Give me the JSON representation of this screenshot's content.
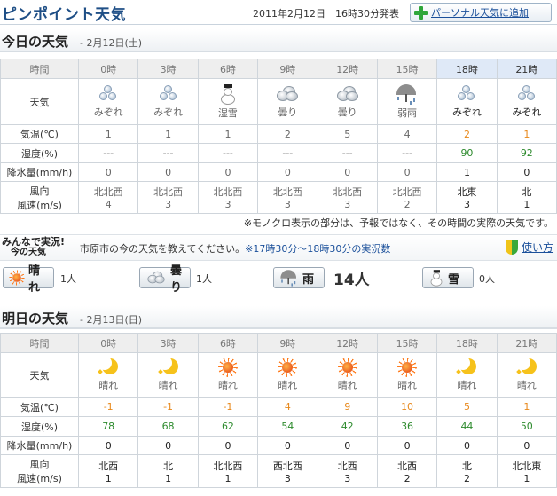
{
  "header": {
    "title": "ピンポイント天気",
    "published": "2011年2月12日　16時30分発表",
    "personal_button": "パーソナル天気に追加"
  },
  "today": {
    "title": "今日の天気",
    "date": "- 2月12日(土)",
    "row_labels": {
      "hour": "時間",
      "weather": "天気",
      "temp": "気温(℃)",
      "humidity": "湿度(%)",
      "precip": "降水量(mm/h)",
      "wind1": "風向",
      "wind2": "風速(m/s)"
    },
    "hours": [
      {
        "hour": "0時",
        "weather": "みぞれ",
        "icon": "sleet-icon",
        "temp": "1",
        "humidity": "---",
        "precip": "0",
        "dir": "北北西",
        "speed": "4",
        "active": false
      },
      {
        "hour": "3時",
        "weather": "みぞれ",
        "icon": "sleet-icon",
        "temp": "1",
        "humidity": "---",
        "precip": "0",
        "dir": "北北西",
        "speed": "3",
        "active": false
      },
      {
        "hour": "6時",
        "weather": "湿雪",
        "icon": "snowman-icon",
        "temp": "1",
        "humidity": "---",
        "precip": "0",
        "dir": "北北西",
        "speed": "3",
        "active": false
      },
      {
        "hour": "9時",
        "weather": "曇り",
        "icon": "cloud-icon",
        "temp": "2",
        "humidity": "---",
        "precip": "0",
        "dir": "北北西",
        "speed": "3",
        "active": false
      },
      {
        "hour": "12時",
        "weather": "曇り",
        "icon": "cloud-icon",
        "temp": "5",
        "humidity": "---",
        "precip": "0",
        "dir": "北北西",
        "speed": "3",
        "active": false
      },
      {
        "hour": "15時",
        "weather": "弱雨",
        "icon": "umbrella-icon",
        "temp": "4",
        "humidity": "---",
        "precip": "0",
        "dir": "北北西",
        "speed": "2",
        "active": false
      },
      {
        "hour": "18時",
        "weather": "みぞれ",
        "icon": "sleet-icon",
        "temp": "2",
        "humidity": "90",
        "precip": "1",
        "dir": "北東",
        "speed": "3",
        "active": true
      },
      {
        "hour": "21時",
        "weather": "みぞれ",
        "icon": "sleet-icon",
        "temp": "1",
        "humidity": "92",
        "precip": "0",
        "dir": "北",
        "speed": "1",
        "active": true
      }
    ],
    "note": "※モノクロ表示の部分は、予報ではなく、その時間の実際の天気です。"
  },
  "minna": {
    "logo_line1": "みんなで実況!",
    "logo_line2": "今の天気",
    "question": "市原市の今の天気を教えてください。",
    "period": "※17時30分～18時30分の実況数",
    "usage": "使い方",
    "votes": [
      {
        "label": "晴れ",
        "icon": "sun-icon",
        "count": "1人"
      },
      {
        "label": "曇り",
        "icon": "cloud-icon",
        "count": "1人"
      },
      {
        "label": "雨",
        "icon": "umbrella-icon",
        "count": "14人"
      },
      {
        "label": "雪",
        "icon": "snowman-icon",
        "count": "0人"
      }
    ]
  },
  "tomorrow": {
    "title": "明日の天気",
    "date": "- 2月13日(日)",
    "row_labels": {
      "hour": "時間",
      "weather": "天気",
      "temp": "気温(℃)",
      "humidity": "湿度(%)",
      "precip": "降水量(mm/h)",
      "wind1": "風向",
      "wind2": "風速(m/s)"
    },
    "hours": [
      {
        "hour": "0時",
        "weather": "晴れ",
        "icon": "moon-icon",
        "temp": "-1",
        "humidity": "78",
        "precip": "0",
        "dir": "北西",
        "speed": "1"
      },
      {
        "hour": "3時",
        "weather": "晴れ",
        "icon": "moon-icon",
        "temp": "-1",
        "humidity": "68",
        "precip": "0",
        "dir": "北",
        "speed": "1"
      },
      {
        "hour": "6時",
        "weather": "晴れ",
        "icon": "sun-icon",
        "temp": "-1",
        "humidity": "62",
        "precip": "0",
        "dir": "北北西",
        "speed": "1"
      },
      {
        "hour": "9時",
        "weather": "晴れ",
        "icon": "sun-icon",
        "temp": "4",
        "humidity": "54",
        "precip": "0",
        "dir": "西北西",
        "speed": "3"
      },
      {
        "hour": "12時",
        "weather": "晴れ",
        "icon": "sun-icon",
        "temp": "9",
        "humidity": "42",
        "precip": "0",
        "dir": "北西",
        "speed": "3"
      },
      {
        "hour": "15時",
        "weather": "晴れ",
        "icon": "sun-icon",
        "temp": "10",
        "humidity": "36",
        "precip": "0",
        "dir": "北西",
        "speed": "2"
      },
      {
        "hour": "18時",
        "weather": "晴れ",
        "icon": "moon-icon",
        "temp": "5",
        "humidity": "44",
        "precip": "0",
        "dir": "北",
        "speed": "2"
      },
      {
        "hour": "21時",
        "weather": "晴れ",
        "icon": "moon-icon",
        "temp": "1",
        "humidity": "50",
        "precip": "0",
        "dir": "北北東",
        "speed": "1"
      }
    ]
  }
}
